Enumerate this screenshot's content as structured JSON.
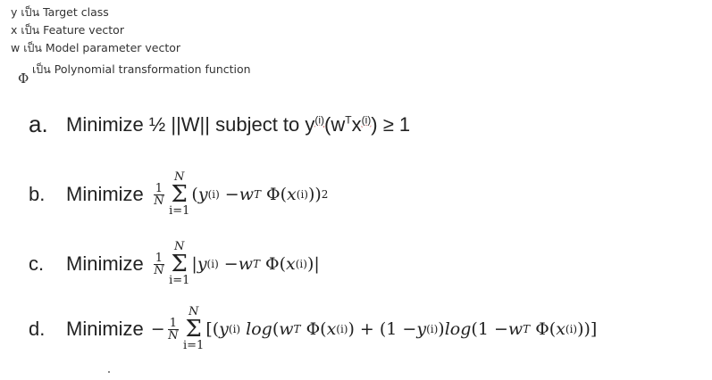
{
  "definitions": [
    {
      "text": "y เป็น Target class"
    },
    {
      "text": "x เป็น Feature vector"
    },
    {
      "text": "w เป็น Model parameter vector"
    },
    {
      "symbol": "Φ",
      "text": "เป็น Polynomial transformation function"
    }
  ],
  "options": {
    "a": {
      "letter": "a.",
      "text": "Minimize ½ ||W|| subject to y",
      "sup_i": "(i)",
      "mid": "(w",
      "sup_T": "T",
      "x": "x",
      "end": ") ≥ 1"
    },
    "b": {
      "letter": "b.",
      "lead": "Minimize",
      "frac_num": "1",
      "frac_den": "N",
      "sum_top": "N",
      "sum_bot": "i=1",
      "sup_i": "(i)",
      "sup_T": "T",
      "sup_2": "2"
    },
    "c": {
      "letter": "c.",
      "lead": "Minimize",
      "frac_num": "1",
      "frac_den": "N",
      "sum_top": "N",
      "sum_bot": "i=1",
      "sup_i": "(i)",
      "sup_T": "T"
    },
    "d": {
      "letter": "d.",
      "lead": "Minimize",
      "frac_num": "1",
      "frac_den": "N",
      "sum_top": "N",
      "sum_bot": "i=1",
      "sup_i": "(i)",
      "sup_T": "T",
      "log": "log"
    }
  },
  "colors": {
    "text": "#222222",
    "spellcheck": "#cc3333"
  }
}
